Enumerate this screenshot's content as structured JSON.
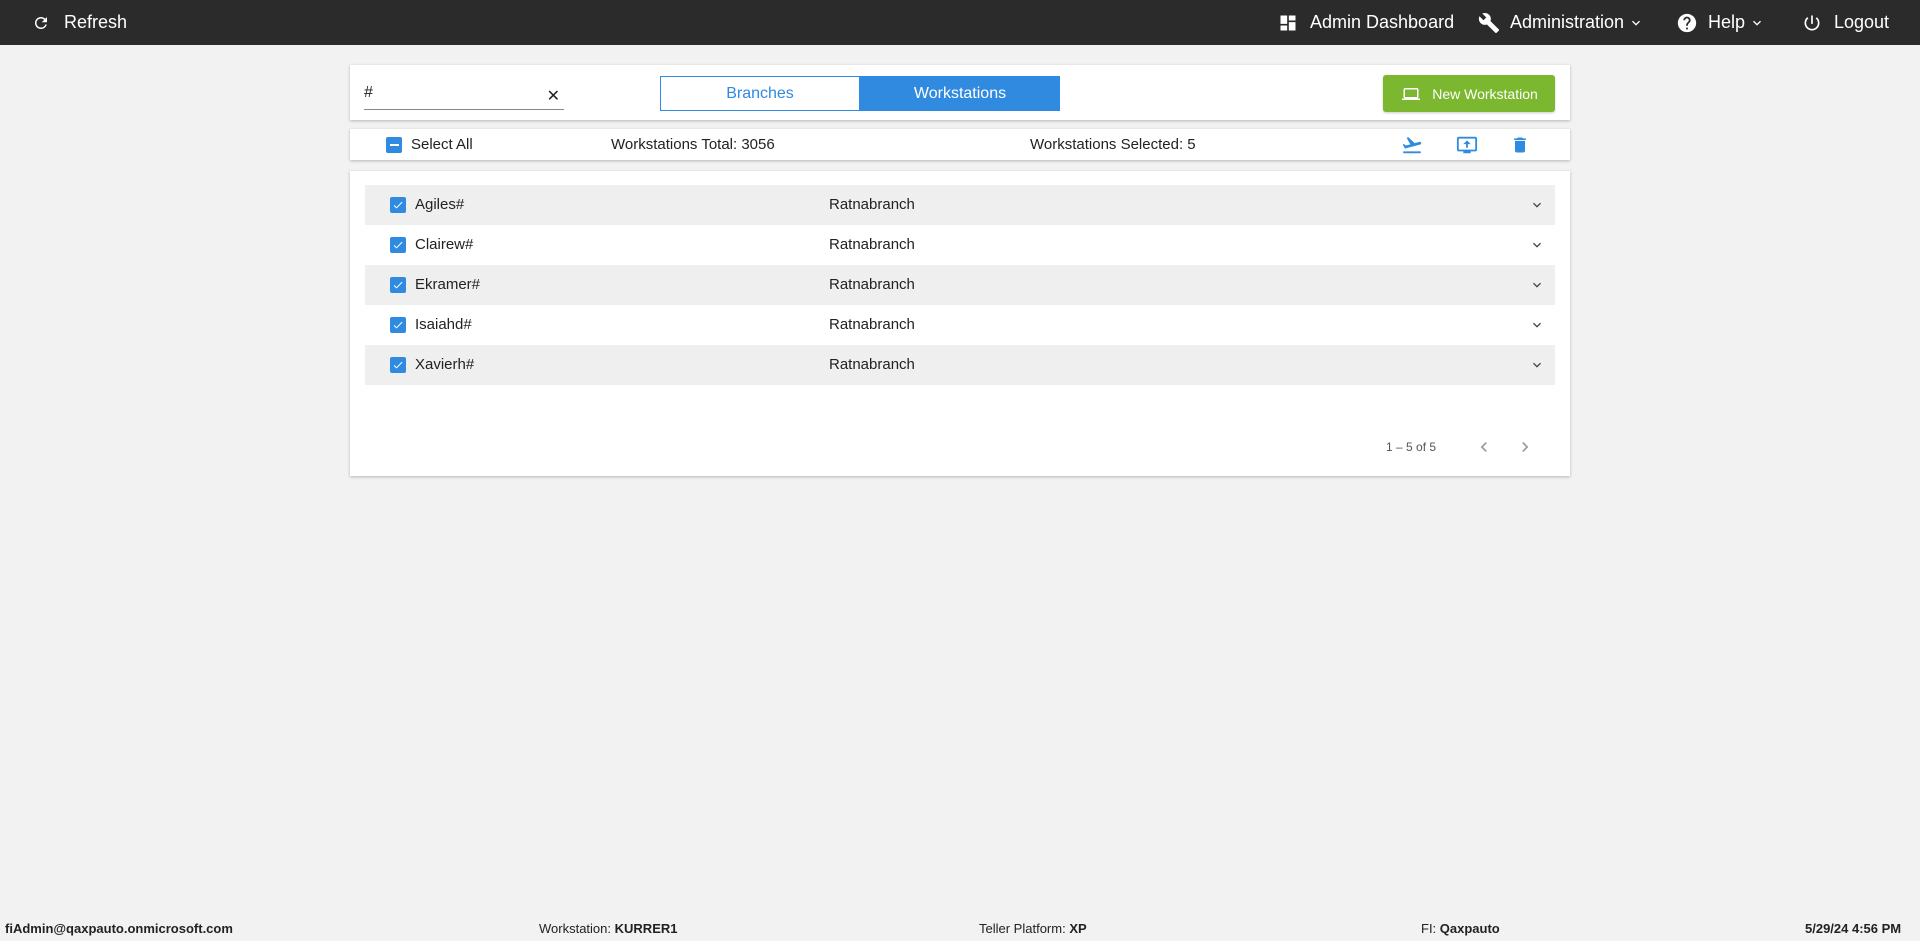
{
  "topbar": {
    "refresh_label": "Refresh",
    "admin_dashboard_label": "Admin Dashboard",
    "administration_label": "Administration",
    "help_label": "Help",
    "logout_label": "Logout"
  },
  "search": {
    "value": "#",
    "clear_glyph": "✕"
  },
  "tabs": [
    {
      "label": "Branches",
      "active": false
    },
    {
      "label": "Workstations",
      "active": true
    }
  ],
  "new_workstation_label": "New Workstation",
  "selection": {
    "select_all_label": "Select All",
    "total_label": "Workstations Total: 3056",
    "selected_label": "Workstations Selected: 5"
  },
  "rows": [
    {
      "name": "Agiles#",
      "branch": "Ratnabranch",
      "checked": true
    },
    {
      "name": "Clairew#",
      "branch": "Ratnabranch",
      "checked": true
    },
    {
      "name": "Ekramer#",
      "branch": "Ratnabranch",
      "checked": true
    },
    {
      "name": "Isaiahd#",
      "branch": "Ratnabranch",
      "checked": true
    },
    {
      "name": "Xavierh#",
      "branch": "Ratnabranch",
      "checked": true
    }
  ],
  "pagination": {
    "range_label": "1 – 5 of 5"
  },
  "footer": {
    "user": "fiAdmin@qaxpauto.onmicrosoft.com",
    "workstation_label": "Workstation:",
    "workstation_value": "KURRER1",
    "platform_label": "Teller Platform:",
    "platform_value": "XP",
    "fi_label": "FI:",
    "fi_value": "Qaxpauto",
    "datetime": "5/29/24 4:56 PM"
  },
  "colors": {
    "topbar": "#2b2b2b",
    "accent_blue": "#2f8ae0",
    "new_button_green": "#7cb82f",
    "background": "#f2f2f2"
  },
  "icons": {
    "refresh": "refresh-icon",
    "dashboard": "dashboard-icon",
    "administration": "wrench-icon",
    "help": "help-icon",
    "logout": "power-icon",
    "new_workstation": "laptop-icon",
    "move": "airplane-icon",
    "export": "upload-icon",
    "delete": "trash-icon"
  }
}
